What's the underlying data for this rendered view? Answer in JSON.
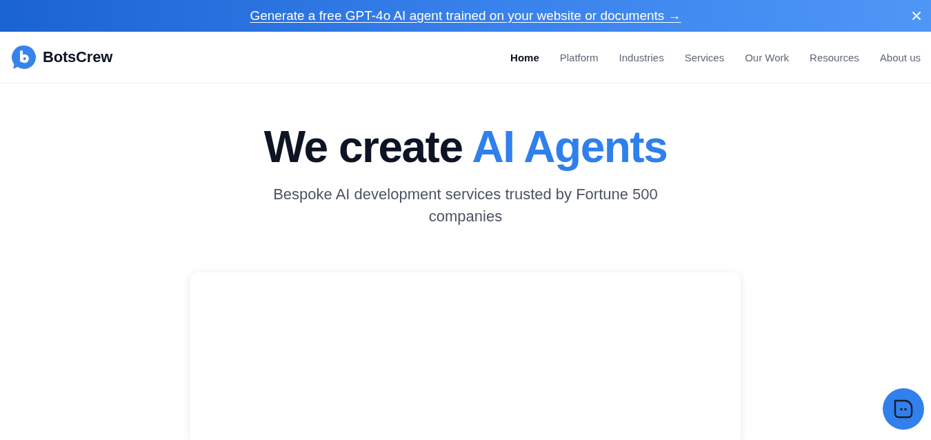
{
  "banner": {
    "link": "Generate a free GPT-4o AI agent trained on your website or documents →"
  },
  "header": {
    "logo": "BotsCrew",
    "nav": [
      {
        "label": "Home",
        "selected": true
      },
      {
        "label": "Platform",
        "selected": false
      },
      {
        "label": "Industries",
        "selected": false
      },
      {
        "label": "Services",
        "selected": false
      },
      {
        "label": "Our Work",
        "selected": false
      },
      {
        "label": "Resources",
        "selected": false
      },
      {
        "label": "About us",
        "selected": false
      }
    ]
  },
  "hero": {
    "title_lead": "We create",
    "title_accent": "AI Agents",
    "subtitle": "Bespoke AI development services trusted by Fortune 500 companies"
  }
}
